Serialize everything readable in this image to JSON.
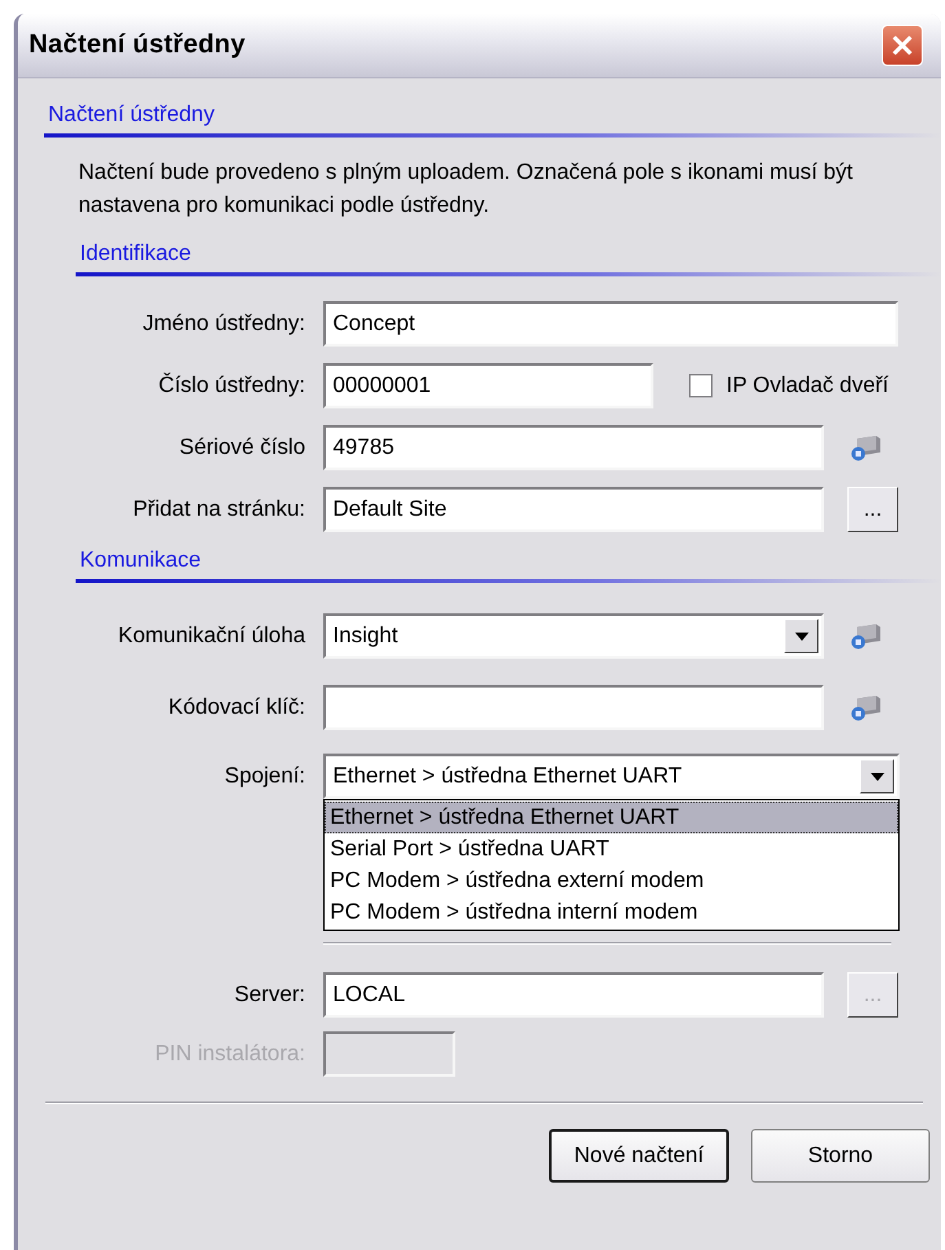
{
  "window": {
    "title": "Načtení ústředny"
  },
  "header": {
    "title": "Načtení ústředny",
    "description": "Načtení bude provedeno s plným uploadem. Označená pole s ikonami musí být nastavena pro komunikaci podle ústředny."
  },
  "identification": {
    "title": "Identifikace",
    "name": {
      "label": "Jméno ústředny:",
      "value": "Concept"
    },
    "number": {
      "label": "Číslo ústředny:",
      "value": "00000001"
    },
    "door_controller": {
      "label": "IP Ovladač dveří",
      "checked": false
    },
    "serial": {
      "label": "Sériové číslo",
      "value": "49785"
    },
    "site": {
      "label": "Přidat na stránku:",
      "value": "Default Site",
      "button": "...",
      "disabled": false
    }
  },
  "communication": {
    "title": "Komunikace",
    "task": {
      "label": "Komunikační úloha",
      "value": "Insight"
    },
    "key": {
      "label": "Kódovací klíč:"
    },
    "connection": {
      "label": "Spojení:",
      "value": "Ethernet > ústředna Ethernet UART",
      "options": [
        {
          "label": "Ethernet > ústředna Ethernet UART",
          "selected": true
        },
        {
          "label": "Serial Port > ústředna UART",
          "selected": false
        },
        {
          "label": "PC Modem > ústředna externí modem",
          "selected": false
        },
        {
          "label": "PC Modem > ústředna interní modem",
          "selected": false
        }
      ]
    },
    "server": {
      "label": "Server:",
      "value": "LOCAL",
      "button": "...",
      "disabled": true
    },
    "pin": {
      "label": "PIN instalátora:",
      "disabled": true
    }
  },
  "buttons": [
    {
      "label": "Nové načtení",
      "default": true
    },
    {
      "label": "Storno",
      "default": false
    }
  ]
}
